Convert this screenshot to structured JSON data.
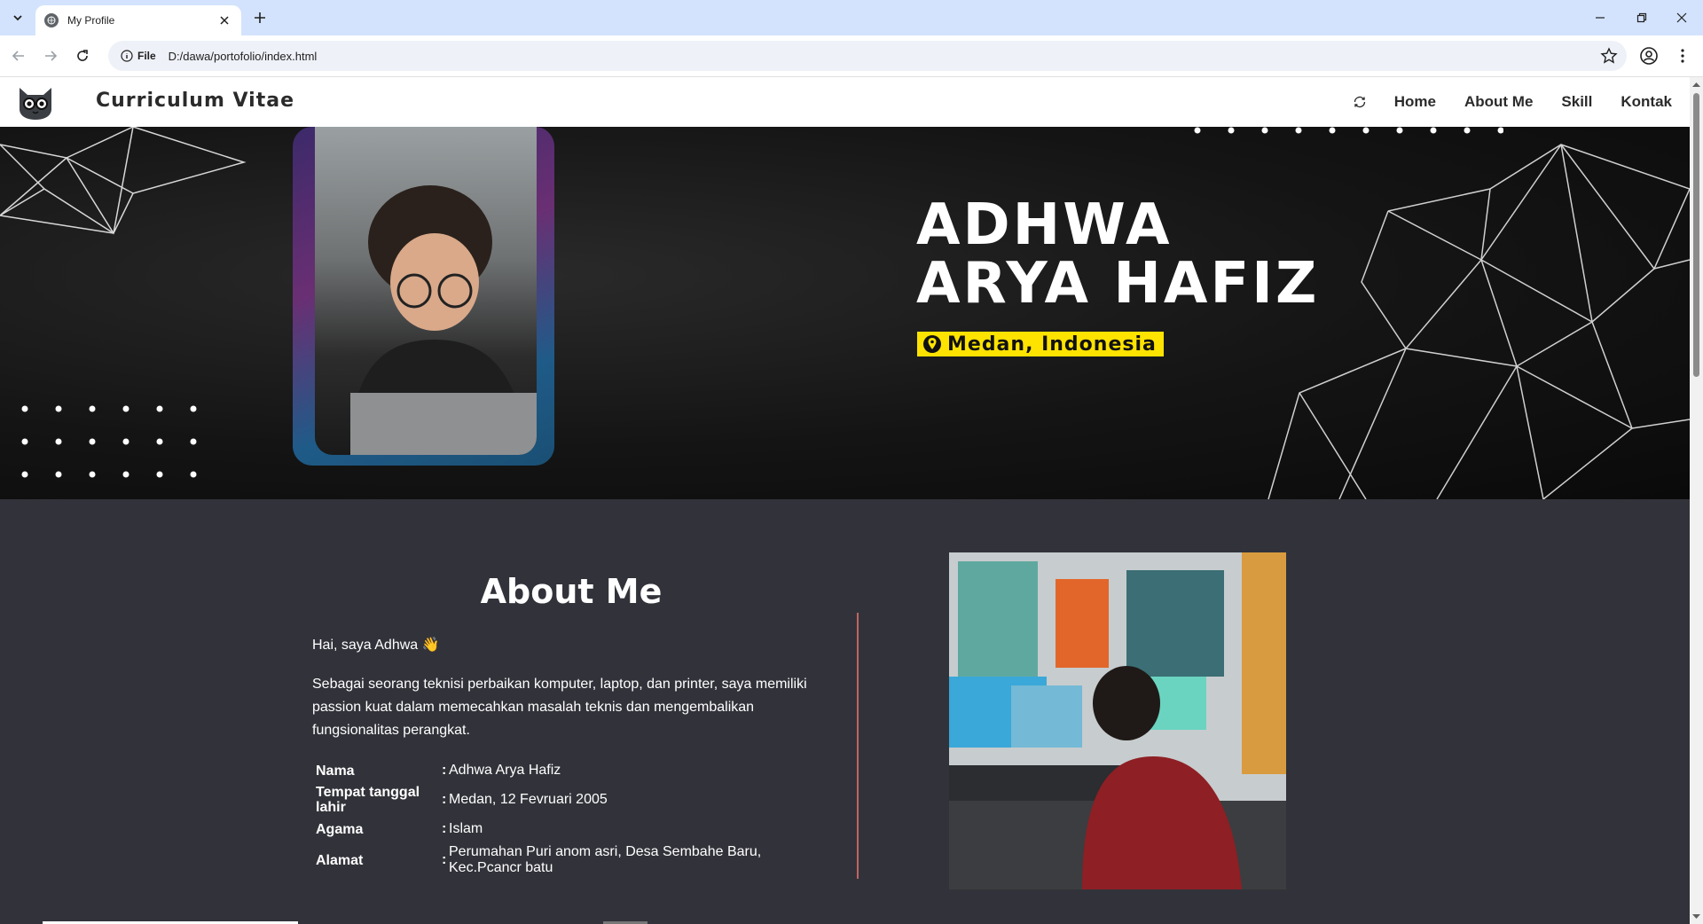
{
  "browser": {
    "tab_title": "My Profile",
    "url_chip": "File",
    "url": "D:/dawa/portofolio/index.html"
  },
  "site": {
    "brand": "Curriculum Vitae",
    "nav": [
      "Home",
      "About Me",
      "Skill",
      "Kontak"
    ]
  },
  "hero": {
    "name_line1": "ADHWA",
    "name_line2": "ARYA HAFIZ",
    "location": "Medan, Indonesia"
  },
  "about": {
    "title": "About Me",
    "greeting": "Hai, saya Adhwa 👋",
    "intro": "Sebagai seorang teknisi perbaikan komputer, laptop, dan printer, saya memiliki passion kuat dalam memecahkan masalah teknis dan mengembalikan fungsionalitas perangkat.",
    "info": [
      {
        "label": "Nama",
        "value": "Adhwa Arya Hafiz"
      },
      {
        "label": "Tempat tanggal lahir",
        "value": "Medan, 12 Fevruari 2005"
      },
      {
        "label": "Agama",
        "value": "Islam"
      },
      {
        "label": "Alamat",
        "value": "Perumahan Puri anom asri, Desa Sembahe Baru, Kec.Pcancr batu"
      }
    ],
    "colon": ":"
  },
  "colors": {
    "tabstrip": "#d3e3fd",
    "page_bg": "#32333a",
    "location_badge": "#ffe300",
    "divider": "#c06560"
  }
}
